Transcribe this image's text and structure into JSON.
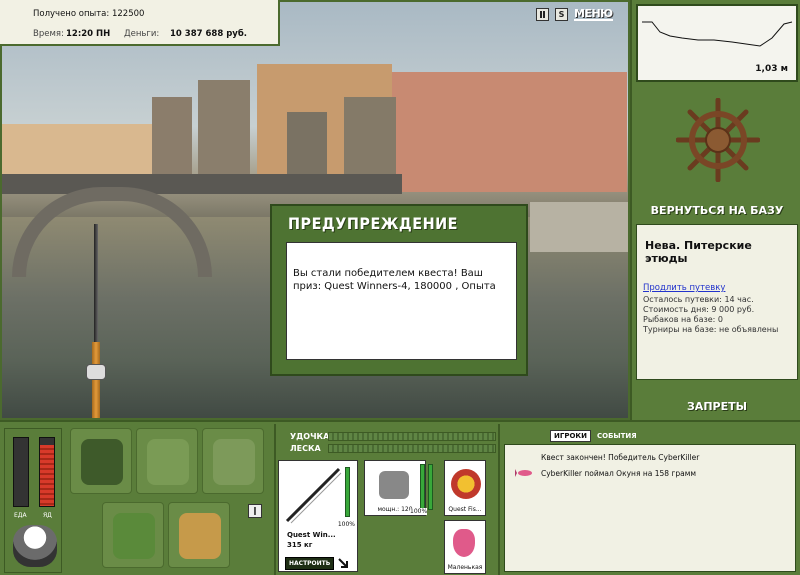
{
  "status": {
    "xp_label": "Получено опыта:",
    "xp_value": "122500",
    "time_label": "Время:",
    "time_value": "12:20 ПН",
    "money_label": "Деньги:",
    "money_value": "10 387 688 руб."
  },
  "top": {
    "pause_icon": "pause-icon",
    "s_label": "S",
    "menu_label": "МЕНЮ"
  },
  "dialog": {
    "title": "ПРЕДУПРЕЖДЕНИЕ",
    "message": "Вы стали победителем квеста! Ваш приз: Quest Winners-4, 180000 , Опыта"
  },
  "depth": {
    "value": "1,03 м"
  },
  "right": {
    "back_to_base": "ВЕРНУТЬСЯ НА БАЗУ",
    "location": "Нева. Питерские этюды",
    "extend_trip": "Продлить путевку",
    "trip_left": "Осталось путевки: 14 час.",
    "day_cost": "Стоимость дня: 9 000 руб.",
    "anglers": "Рыбаков на базе: 0",
    "tournaments": "Турниры на базе: не объявлены",
    "bans": "ЗАПРЕТЫ"
  },
  "meters": {
    "food_label": "ЕДА",
    "bait_label": "ЯД",
    "food_level": 0.0,
    "bait_level": 0.9
  },
  "gear": {
    "rod_label": "УДОЧКА",
    "line_label": "ЛЕСКА",
    "rod_name": "Quest Win...",
    "rod_weight": "315 кг",
    "rod_percent": "100%",
    "reel_caption": "мощн.: 120",
    "reel_percent": "100%",
    "line_caption": "Quest Fis...",
    "lure_caption": "Маленькая",
    "setup_button": "НАСТРОИТЬ"
  },
  "chat": {
    "tab_players": "ИГРОКИ",
    "tab_events": "СОБЫТИЯ",
    "msg1": "Квест закончен! Победитель CyberKiller",
    "msg2": "CyberKiller поймал Окуня на 158 грамм"
  },
  "colors": {
    "panel_green": "#5a7d3a",
    "accent_green": "#38a83a",
    "bait_red": "#d83a2a"
  }
}
